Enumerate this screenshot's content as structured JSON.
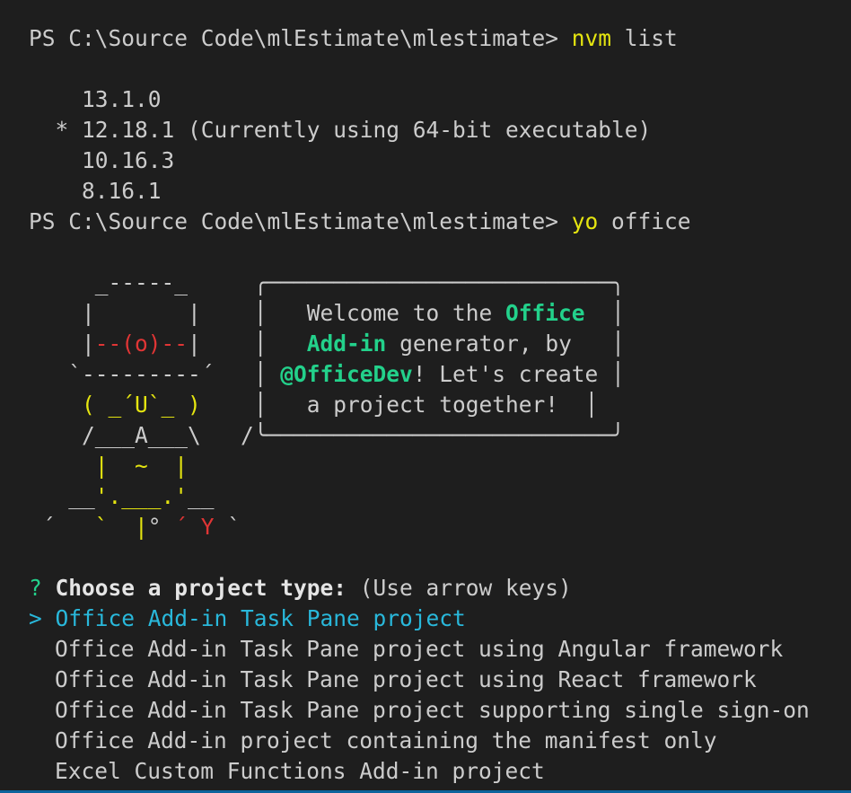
{
  "prompt1": {
    "path": "PS C:\\Source Code\\mlEstimate\\mlestimate> ",
    "cmd": "nvm",
    "args": " list"
  },
  "nvm_versions": [
    "    13.1.0",
    "  * 12.18.1 (Currently using 64-bit executable)",
    "    10.16.3",
    "    8.16.1"
  ],
  "prompt2": {
    "path": "PS C:\\Source Code\\mlEstimate\\mlestimate> ",
    "cmd": "yo",
    "args": " office"
  },
  "yeoman": {
    "l1": "     _-----_     ╭──────────────────────────╮",
    "l2a": "    |       |    │   Welcome to the ",
    "l2b": "Office",
    "l2c": "  │",
    "l3a": "    |",
    "l3b": "--(o)--",
    "l3c": "|    │   ",
    "l3d": "Add-in",
    "l3e": " generator, by   │",
    "l4a": "   `---------´   │ ",
    "l4b": "@OfficeDev",
    "l4c": "! Let's create │",
    "l5a": "    ",
    "l5b": "( _´U`_ )",
    "l5c": "    │   a project together!  │",
    "l6": "    /___A___\\   /╰──────────────────────────╯",
    "l7a": "     ",
    "l7b": "|  ~  |",
    "l8a": "   __",
    "l8b": "'.___.'",
    "l8c": "__",
    "l9a": " ´   ",
    "l9b": "`  |",
    "l9c": "° ",
    "l9d": "´ Y",
    "l9e": " `"
  },
  "question": {
    "mark": "? ",
    "label": "Choose a project type:",
    "hint": " (Use arrow keys)"
  },
  "options": [
    {
      "label": "Office Add-in Task Pane project",
      "selected": true
    },
    {
      "label": "Office Add-in Task Pane project using Angular framework",
      "selected": false
    },
    {
      "label": "Office Add-in Task Pane project using React framework",
      "selected": false
    },
    {
      "label": "Office Add-in Task Pane project supporting single sign-on",
      "selected": false
    },
    {
      "label": "Office Add-in project containing the manifest only",
      "selected": false
    },
    {
      "label": "Excel Custom Functions Add-in project",
      "selected": false
    }
  ],
  "pointer": "> ",
  "colors": {
    "background": "#1e1e1e",
    "text": "#cccccc",
    "command": "#e5e510",
    "accent_green": "#23d18b",
    "selected": "#29b8db",
    "red": "#e03535"
  }
}
